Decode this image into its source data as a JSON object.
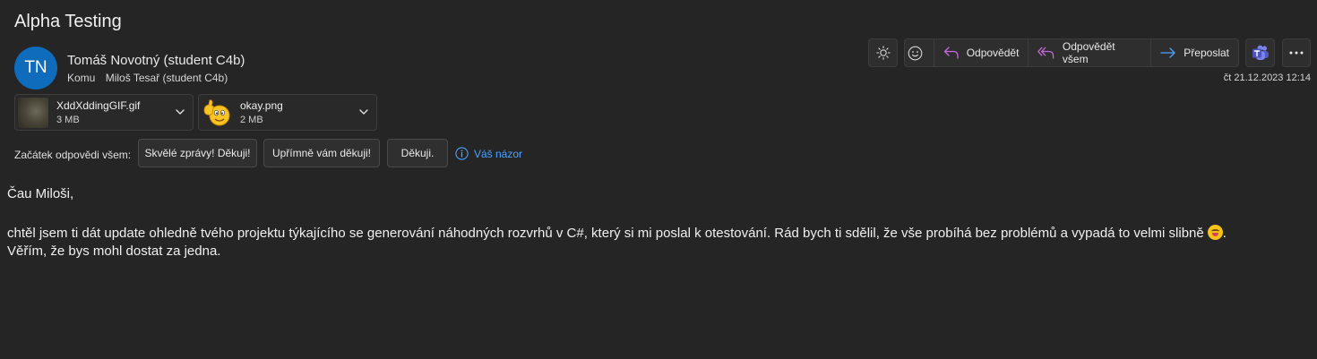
{
  "email": {
    "subject": "Alpha Testing",
    "avatar_initials": "TN",
    "avatar_color": "#0f6cbd",
    "sender": "Tomáš Novotný (student C4b)",
    "to_label": "Komu",
    "to_name": "Miloš Tesař (student C4b)",
    "date": "čt 21.12.2023 12:14"
  },
  "toolbar": {
    "reply": "Odpovědět",
    "reply_all": "Odpovědět všem",
    "forward": "Přeposlat",
    "icons": [
      "sun-icon",
      "emoji-icon",
      "reply-icon",
      "reply-all-icon",
      "forward-icon",
      "teams-icon",
      "more-icon"
    ],
    "accent_reply": "#c06bd8",
    "accent_forward": "#4aa3ff"
  },
  "attachments": [
    {
      "name": "XddXddingGIF.gif",
      "size": "3 MB"
    },
    {
      "name": "okay.png",
      "size": "2 MB"
    }
  ],
  "quick_replies": {
    "label": "Začátek odpovědi všem:",
    "options": [
      "Skvělé zprávy! Děkuji!",
      "Upřímně vám děkuji!",
      "Děkuji."
    ],
    "feedback": "Váš názor"
  },
  "body": {
    "greeting": "Čau Miloši,",
    "line1": "chtěl jsem ti dát update ohledně tvého projektu týkajícího se generování náhodných rozvrhů v C#, který si mi poslal k otestování. Rád bych ti sdělil, že vše probíhá bez problémů a vypadá to velmi slibně",
    "line1_end": ".",
    "line2": "Věřím, že bys mohl dostat za jedna."
  }
}
